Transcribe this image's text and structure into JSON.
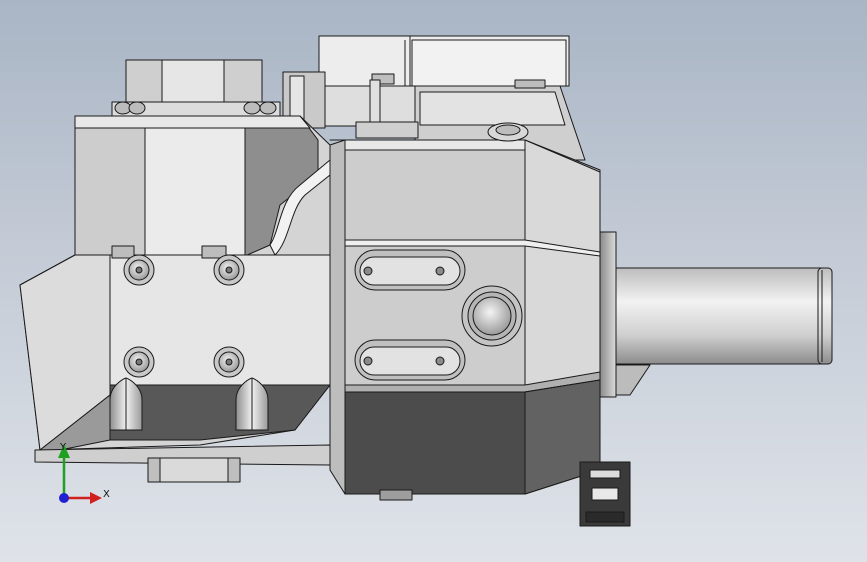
{
  "triad": {
    "x_label": "X",
    "y_label": "Y",
    "x_color": "#d02020",
    "y_color": "#20a020",
    "z_color": "#2020d0"
  },
  "colors": {
    "edge": "#1a1a1a",
    "light_face": "#e2e2e2",
    "mid_face": "#c9c9c9",
    "dark_face": "#7a7a7a",
    "shadow_face": "#4f4f4f"
  }
}
